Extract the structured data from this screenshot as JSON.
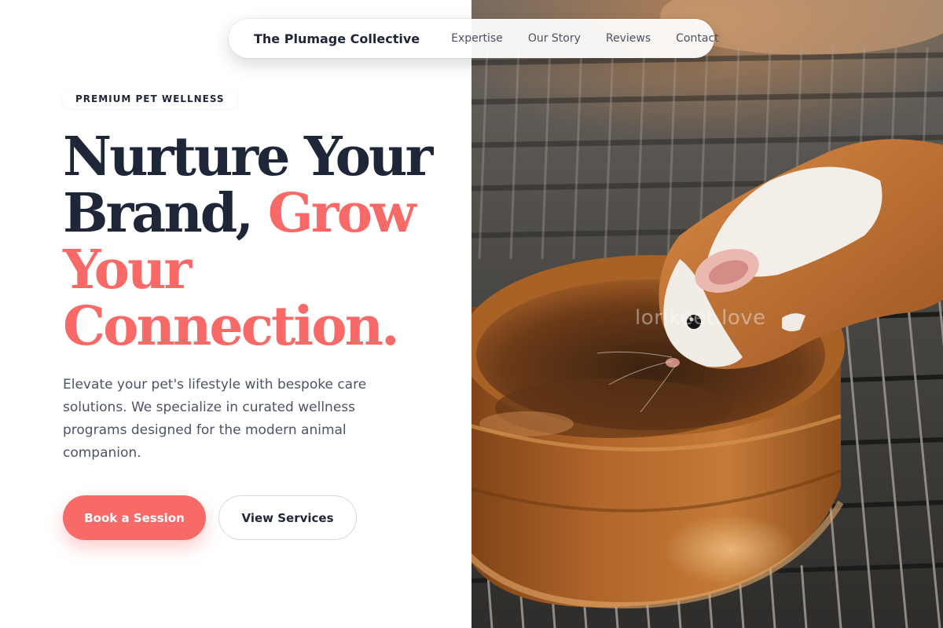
{
  "nav": {
    "brand": "The Plumage Collective",
    "links": [
      "Expertise",
      "Our Story",
      "Reviews",
      "Contact"
    ]
  },
  "hero": {
    "badge": "PREMIUM PET WELLNESS",
    "headline_dark": "Nurture Your Brand, ",
    "headline_accent": "Grow Your Connection.",
    "description": "Elevate your pet's lifestyle with bespoke care solutions. We specialize in curated wellness programs designed for the modern animal companion.",
    "primary_cta": "Book a Session",
    "secondary_cta": "View Services",
    "photo_subject": "guinea pig drinking from a rustic bowl",
    "watermark": "lorikeet.love"
  },
  "colors": {
    "accent": "#f76a68",
    "heading": "#1e2638",
    "body_text": "#4b5364",
    "background": "#ffffff"
  },
  "icons": []
}
